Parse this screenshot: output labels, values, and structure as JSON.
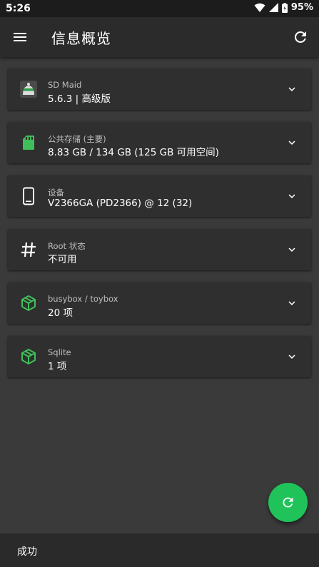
{
  "status_bar": {
    "time": "5:26",
    "battery": "95%",
    "icons": [
      "wifi-icon",
      "signal-icon",
      "battery-icon"
    ]
  },
  "app_bar": {
    "title": "信息概览",
    "icons": [
      "menu-icon",
      "refresh-icon"
    ]
  },
  "cards": [
    {
      "label": "SD Maid",
      "value": "5.6.3 | 高级版",
      "icon": "sdmaid-logo-icon"
    },
    {
      "label": "公共存储 (主要)",
      "value": "8.83 GB / 134 GB (125 GB 可用空间)",
      "icon": "sd-card-icon"
    },
    {
      "label": "设备",
      "value": "V2366GA (PD2366) @ 12 (32)",
      "icon": "phone-icon"
    },
    {
      "label": "Root 状态",
      "value": "不可用",
      "icon": "hash-icon"
    },
    {
      "label": "busybox / toybox",
      "value": "20 项",
      "icon": "package-icon"
    },
    {
      "label": "Sqlite",
      "value": "1 项",
      "icon": "package-icon"
    }
  ],
  "snackbar": {
    "message": "成功"
  },
  "colors": {
    "accent": "#1fc35a",
    "background": "#3a3a3a",
    "card": "#2f2f2f",
    "appbar": "#2b2b2b"
  }
}
